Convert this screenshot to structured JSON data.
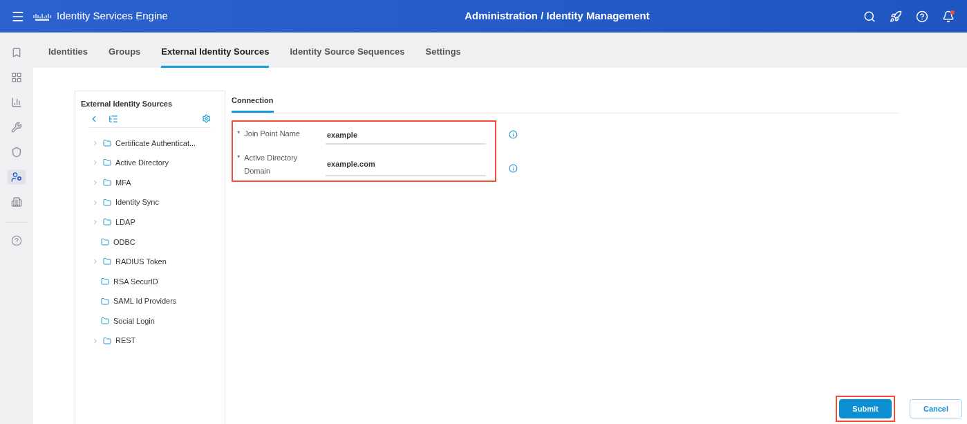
{
  "header": {
    "product": "Identity Services Engine",
    "page_title": "Administration / Identity Management",
    "notification_badge": true
  },
  "tabs": [
    {
      "label": "Identities",
      "selected": false
    },
    {
      "label": "Groups",
      "selected": false
    },
    {
      "label": "External Identity Sources",
      "selected": true
    },
    {
      "label": "Identity Source Sequences",
      "selected": false
    },
    {
      "label": "Settings",
      "selected": false
    }
  ],
  "rail": {
    "items": [
      {
        "selected": false
      },
      {
        "selected": false
      },
      {
        "selected": false
      },
      {
        "selected": false
      },
      {
        "selected": false
      },
      {
        "selected": true
      },
      {
        "selected": false
      }
    ]
  },
  "tree": {
    "title": "External Identity Sources",
    "items": [
      {
        "label": "Certificate Authenticat...",
        "expandable": true
      },
      {
        "label": "Active Directory",
        "expandable": true
      },
      {
        "label": "MFA",
        "expandable": true
      },
      {
        "label": "Identity Sync",
        "expandable": true
      },
      {
        "label": "LDAP",
        "expandable": true
      },
      {
        "label": "ODBC",
        "expandable": false
      },
      {
        "label": "RADIUS Token",
        "expandable": true
      },
      {
        "label": "RSA SecurID",
        "expandable": false
      },
      {
        "label": "SAML Id Providers",
        "expandable": false
      },
      {
        "label": "Social Login",
        "expandable": false
      },
      {
        "label": "REST",
        "expandable": true
      }
    ]
  },
  "form": {
    "tab": {
      "label": "Connection",
      "selected": true
    },
    "highlighted": true,
    "fields": [
      {
        "required_mark": "*",
        "label": "Join Point Name",
        "value": "example"
      },
      {
        "required_mark": "*",
        "label": "Active Directory Domain",
        "value": "example.com"
      }
    ]
  },
  "buttons": [
    {
      "label": "Submit",
      "kind": "primary",
      "highlighted": true
    },
    {
      "label": "Cancel",
      "kind": "secondary",
      "highlighted": false
    }
  ]
}
